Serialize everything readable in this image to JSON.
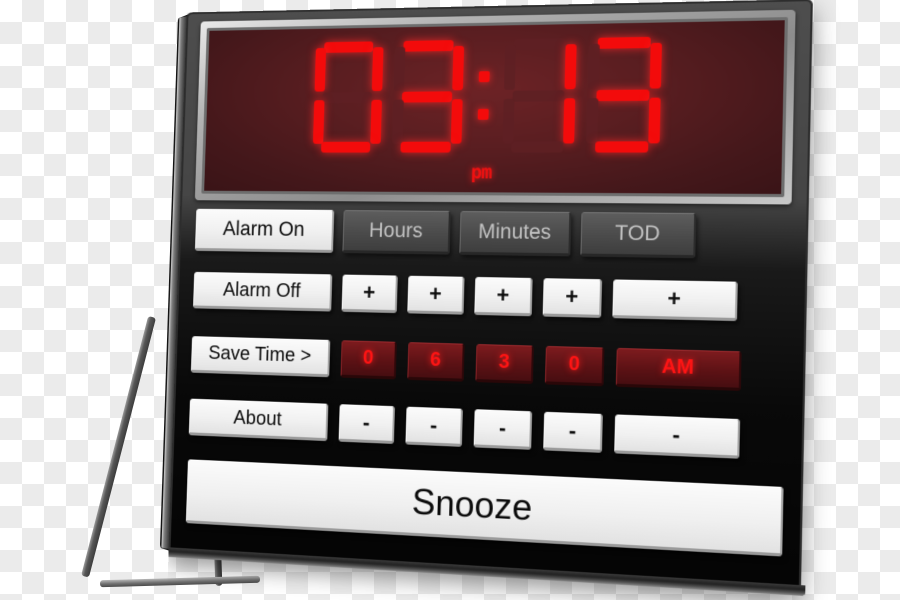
{
  "device": {
    "name": "digital-alarm-clock",
    "colors": {
      "display_background": "#5a1e21",
      "led_red": "#f30b0b",
      "body_dark": "#0a0a0a",
      "panel_gray": "#4e4e4e",
      "button_light": "#f0f0f0",
      "button_dark": "#4b4b4b"
    }
  },
  "display": {
    "digits": [
      "0",
      "3",
      "1",
      "3"
    ],
    "separator": ":",
    "time_text": "03:13",
    "meridiem_indicator": "pm"
  },
  "keypad": {
    "row1": [
      {
        "label": "Alarm On",
        "style": "light",
        "width": "label"
      },
      {
        "label": "Hours",
        "style": "dark",
        "width": "wide"
      },
      {
        "label": "Minutes",
        "style": "dark",
        "width": "wide"
      },
      {
        "label": "TOD",
        "style": "dark",
        "width": "wide"
      }
    ],
    "row2": [
      {
        "label": "Alarm Off",
        "style": "light",
        "width": "label"
      },
      {
        "label": "+",
        "style": "light",
        "width": "small"
      },
      {
        "label": "+",
        "style": "light",
        "width": "small"
      },
      {
        "label": "+",
        "style": "light",
        "width": "small"
      },
      {
        "label": "+",
        "style": "light",
        "width": "small"
      },
      {
        "label": "+",
        "style": "light",
        "width": "last"
      }
    ],
    "row3": [
      {
        "label": "Save Time >",
        "style": "light",
        "width": "label"
      },
      {
        "label": "0",
        "style": "led",
        "width": "small"
      },
      {
        "label": "6",
        "style": "led",
        "width": "small"
      },
      {
        "label": "3",
        "style": "led",
        "width": "small"
      },
      {
        "label": "0",
        "style": "led",
        "width": "small"
      },
      {
        "label": "AM",
        "style": "led",
        "width": "last"
      }
    ],
    "row4": [
      {
        "label": "About",
        "style": "light",
        "width": "label"
      },
      {
        "label": "-",
        "style": "light",
        "width": "small"
      },
      {
        "label": "-",
        "style": "light",
        "width": "small"
      },
      {
        "label": "-",
        "style": "light",
        "width": "small"
      },
      {
        "label": "-",
        "style": "light",
        "width": "small"
      },
      {
        "label": "-",
        "style": "light",
        "width": "last"
      }
    ],
    "snooze": {
      "label": "Snooze",
      "style": "light"
    }
  },
  "alarm_setting": {
    "hour_tens": "0",
    "hour_ones": "6",
    "minute_tens": "3",
    "minute_ones": "0",
    "meridiem": "AM"
  },
  "stand": {
    "name": "kickstand",
    "pivot_left": "pivot-pin-left",
    "pivot_right": "pivot-pin-right"
  }
}
